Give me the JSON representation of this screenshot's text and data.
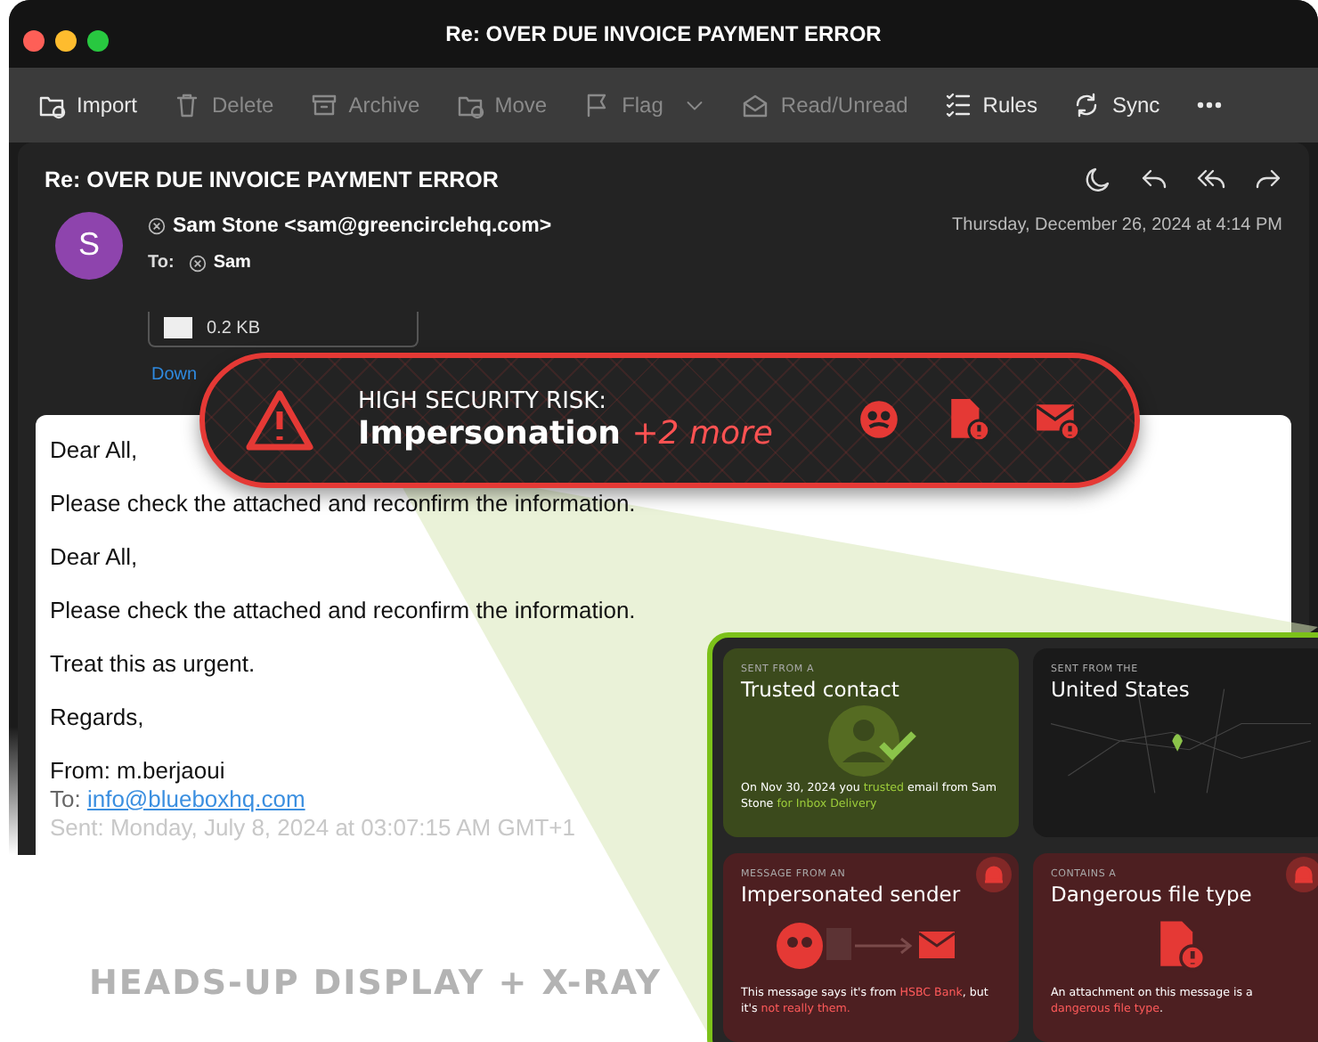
{
  "window": {
    "title": "Re: OVER DUE INVOICE PAYMENT ERROR"
  },
  "toolbar": [
    {
      "kind": "import",
      "label": "Import",
      "disabled": false
    },
    {
      "kind": "trash",
      "label": "Delete",
      "disabled": true
    },
    {
      "kind": "archive",
      "label": "Archive",
      "disabled": true
    },
    {
      "kind": "move",
      "label": "Move",
      "disabled": true
    },
    {
      "kind": "flag",
      "label": "Flag",
      "disabled": true,
      "dropdown": true
    },
    {
      "kind": "envelope",
      "label": "Read/Unread",
      "disabled": true
    },
    {
      "kind": "rules",
      "label": "Rules",
      "disabled": false
    },
    {
      "kind": "sync",
      "label": "Sync",
      "disabled": false
    },
    {
      "kind": "more",
      "disabled": false
    }
  ],
  "message": {
    "subject": "Re: OVER DUE INVOICE PAYMENT ERROR",
    "avatar_letter": "S",
    "sender": "Sam Stone <sam@greencirclehq.com>",
    "to_label": "To:",
    "recipient": "Sam",
    "date": "Thursday, December 26, 2024 at 4:14 PM",
    "attachment": {
      "size": "0.2 KB",
      "link": "Down"
    },
    "body": [
      {
        "kind": "para",
        "text": "Dear All,"
      },
      {
        "kind": "para",
        "text": "Please check the attached and reconfirm the information."
      },
      {
        "kind": "para",
        "text": "Dear All,"
      },
      {
        "kind": "para",
        "text": "Please check the attached and reconfirm the information."
      },
      {
        "kind": "para",
        "text": "Treat this as urgent."
      },
      {
        "kind": "para",
        "text": "Regards,"
      },
      {
        "kind": "from",
        "text": "From: m.berjaoui"
      },
      {
        "kind": "to",
        "text": "To:",
        "link": "info@blueboxhq.com"
      },
      {
        "kind": "sent",
        "text": "Sent: Monday, July 8, 2024 at 03:07:15 AM GMT+1"
      }
    ]
  },
  "alert": {
    "heading": "HIGH SECURITY RISK:",
    "threat": "Impersonation",
    "more": "+2 more"
  },
  "xray": {
    "cards": [
      {
        "kind": "trusted",
        "eyebrow": "SENT FROM A",
        "title": "Trusted contact",
        "description": [
          {
            "text": "On Nov 30, 2024 you ",
            "highlight": false
          },
          {
            "text": "trusted",
            "highlight": true
          },
          {
            "text": " email from Sam Stone ",
            "highlight": false
          },
          {
            "text": "for Inbox Delivery",
            "highlight": true
          }
        ]
      },
      {
        "kind": "map",
        "eyebrow": "SENT FROM THE",
        "title": "United States"
      },
      {
        "kind": "impersonated",
        "eyebrow": "MESSAGE FROM AN",
        "title": "Impersonated sender",
        "description": [
          {
            "text": "This message says it's from ",
            "highlight": false
          },
          {
            "text": "HSBC Bank",
            "highlight": true
          },
          {
            "text": ", but it's ",
            "highlight": false
          },
          {
            "text": "not really them.",
            "highlight": true
          }
        ]
      },
      {
        "kind": "file",
        "eyebrow": "CONTAINS A",
        "title": "Dangerous file type",
        "description": [
          {
            "text": "An attachment on this message is a ",
            "highlight": false
          },
          {
            "text": "dangerous file type",
            "highlight": true
          },
          {
            "text": ".",
            "highlight": false
          }
        ]
      }
    ]
  },
  "caption": "HEADS-UP DISPLAY + X-RAY"
}
